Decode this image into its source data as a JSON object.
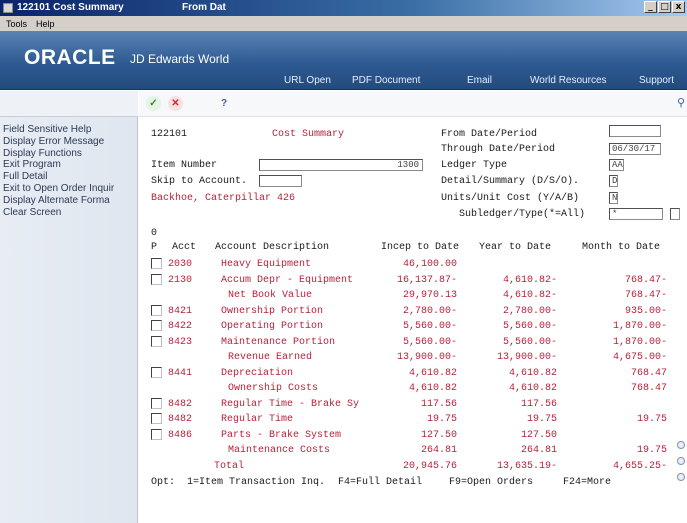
{
  "window": {
    "title": "122101   Cost Summary",
    "subtitle": "From Dat",
    "controls": [
      "_",
      "□",
      "x"
    ]
  },
  "menu": [
    "Tools",
    "Help"
  ],
  "banner": {
    "logo": "ORACLE",
    "product": "JD Edwards World",
    "links": [
      "URL Open",
      "PDF Document",
      "Email",
      "World Resources",
      "Support"
    ]
  },
  "toolbar": {
    "ok": "✓",
    "cancel": "✕",
    "help": "?",
    "find": "🔍"
  },
  "sidebar": {
    "items": [
      "Field Sensitive Help",
      "Display Error Message",
      "Display Functions",
      "Exit Program",
      "Full Detail",
      "Exit to Open Order Inquir",
      "Display Alternate Forma",
      "Clear Screen"
    ]
  },
  "form": {
    "program_id": "122101",
    "form_title": "Cost Summary",
    "item_number_label": "Item Number",
    "item_number_value": "1300",
    "skip_label": "Skip to Account.",
    "skip_value": "",
    "item_description": "Backhoe, Caterpillar 426",
    "from_period_label": "From Date/Period",
    "from_period_value": "",
    "through_period_label": "Through Date/Period",
    "through_period_value": "06/30/17",
    "ledger_type_label": "Ledger Type",
    "ledger_type_value": "AA",
    "detail_summary_label": "Detail/Summary (D/S/O).",
    "detail_summary_value": "D",
    "units_cost_label": "Units/Unit Cost (Y/A/B)",
    "units_cost_value": "N",
    "subledger_label": "Subledger/Type(*=All)",
    "subledger_value": "*",
    "subledger_type_value": ""
  },
  "grid": {
    "count": "0",
    "headers": {
      "p": "P",
      "acct": "Acct",
      "description": "Account Description",
      "incep": "Incep to Date",
      "year": "Year to Date",
      "month": "Month to Date"
    },
    "rows": [
      {
        "opt": true,
        "acct": "2030",
        "desc": "Heavy Equipment",
        "indent": false,
        "incep": "46,100.00",
        "year": "",
        "month": ""
      },
      {
        "opt": true,
        "acct": "2130",
        "desc": "Accum Depr - Equipment",
        "indent": false,
        "incep": "16,137.87-",
        "year": "4,610.82-",
        "month": "768.47-"
      },
      {
        "opt": false,
        "acct": "",
        "desc": "Net Book Value",
        "indent": true,
        "incep": "29,970.13",
        "year": "4,610.82-",
        "month": "768.47-"
      },
      {
        "opt": true,
        "acct": "8421",
        "desc": "Ownership Portion",
        "indent": false,
        "incep": "2,780.00-",
        "year": "2,780.00-",
        "month": "935.00-"
      },
      {
        "opt": true,
        "acct": "8422",
        "desc": "Operating Portion",
        "indent": false,
        "incep": "5,560.00-",
        "year": "5,560.00-",
        "month": "1,870.00-"
      },
      {
        "opt": true,
        "acct": "8423",
        "desc": "Maintenance Portion",
        "indent": false,
        "incep": "5,560.00-",
        "year": "5,560.00-",
        "month": "1,870.00-"
      },
      {
        "opt": false,
        "acct": "",
        "desc": "Revenue Earned",
        "indent": true,
        "incep": "13,900.00-",
        "year": "13,900.00-",
        "month": "4,675.00-"
      },
      {
        "opt": true,
        "acct": "8441",
        "desc": "Depreciation",
        "indent": false,
        "incep": "4,610.82",
        "year": "4,610.82",
        "month": "768.47"
      },
      {
        "opt": false,
        "acct": "",
        "desc": "Ownership Costs",
        "indent": true,
        "incep": "4,610.82",
        "year": "4,610.82",
        "month": "768.47"
      },
      {
        "opt": true,
        "acct": "8482",
        "desc": "Regular Time - Brake Sy",
        "indent": false,
        "incep": "117.56",
        "year": "117.56",
        "month": ""
      },
      {
        "opt": true,
        "acct": "8482",
        "desc": "Regular Time",
        "indent": false,
        "incep": "19.75",
        "year": "19.75",
        "month": "19.75"
      },
      {
        "opt": true,
        "acct": "8486",
        "desc": "Parts - Brake System",
        "indent": false,
        "incep": "127.50",
        "year": "127.50",
        "month": ""
      },
      {
        "opt": false,
        "acct": "",
        "desc": "Maintenance Costs",
        "indent": true,
        "incep": "264.81",
        "year": "264.81",
        "month": "19.75"
      },
      {
        "opt": false,
        "acct": "",
        "desc": "Total",
        "indent": false,
        "total": true,
        "incep": "20,945.76",
        "year": "13,635.19-",
        "month": "4,655.25-"
      }
    ]
  },
  "footer": {
    "options": "Opt:  1=Item Transaction Inq.",
    "f4": "F4=Full Detail",
    "f9": "F9=Open Orders",
    "f24": "F24=More"
  }
}
